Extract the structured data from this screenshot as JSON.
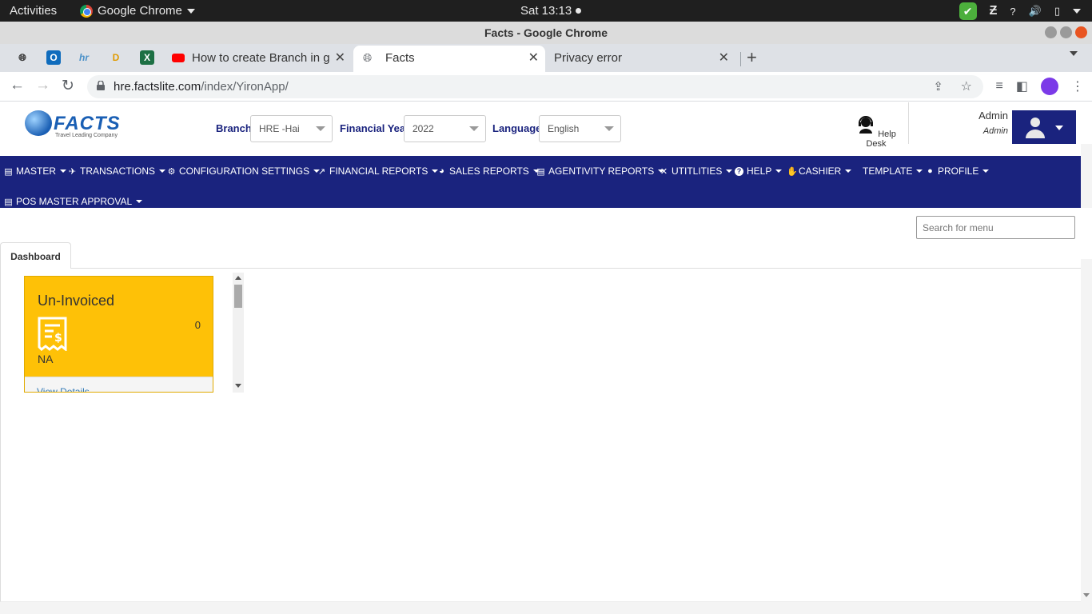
{
  "os_bar": {
    "activities": "Activities",
    "app_name": "Google Chrome",
    "clock": "Sat 13:13"
  },
  "window": {
    "title": "Facts - Google Chrome"
  },
  "browser": {
    "tabs": [
      {
        "title": "How to create Branch in g"
      },
      {
        "title": "Facts"
      },
      {
        "title": "Privacy error"
      }
    ],
    "url_host": "hre.factslite.com",
    "url_path": "/index/YironApp/"
  },
  "header": {
    "logo_text": "FACTS",
    "logo_tagline": "Travel Leading Company",
    "branch_label": "Branch",
    "branch_value": "HRE -Hai",
    "year_label": "Financial Year",
    "year_value": "2022",
    "language_label": "Language",
    "language_value": "English",
    "helpdesk_label": "Help Desk",
    "user_name": "Admin",
    "user_role": "Admin"
  },
  "menu": {
    "items": [
      {
        "label": "MASTER",
        "icon": "document-icon"
      },
      {
        "label": "TRANSACTIONS",
        "icon": "flight-icon"
      },
      {
        "label": "CONFIGURATION SETTINGS",
        "icon": "user-gear-icon"
      },
      {
        "label": "FINANCIAL REPORTS",
        "icon": "chart-line-icon"
      },
      {
        "label": "SALES REPORTS",
        "icon": "pie-chart-icon"
      },
      {
        "label": "AGENTIVITY REPORTS",
        "icon": "document-icon"
      },
      {
        "label": "UTITLITIES",
        "icon": "tools-icon"
      },
      {
        "label": "HELP",
        "icon": "question-icon"
      },
      {
        "label": "CASHIER",
        "icon": "hand-cash-icon"
      },
      {
        "label": "TEMPLATE",
        "icon": ""
      },
      {
        "label": "PROFILE",
        "icon": "user-icon"
      },
      {
        "label": "POS MASTER APPROVAL",
        "icon": "document-icon"
      }
    ]
  },
  "search": {
    "placeholder": "Search for menu"
  },
  "dashboard": {
    "tab_label": "Dashboard",
    "card": {
      "title": "Un-Invoiced",
      "count": "0",
      "subtitle": "NA",
      "link": "View Details",
      "color": "#fec107"
    }
  },
  "colors": {
    "nav_bg": "#1a237e",
    "card_yellow": "#fec107"
  }
}
